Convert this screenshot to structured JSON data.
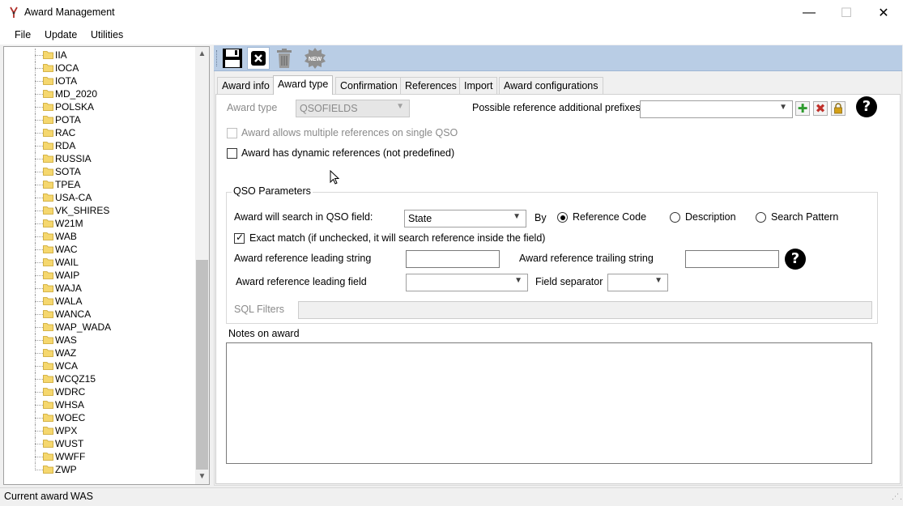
{
  "window": {
    "title": "Award Management",
    "minimize_glyph": "—",
    "maximize_glyph": "☐",
    "close_glyph": "✕"
  },
  "menu": {
    "items": [
      "File",
      "Update",
      "Utilities"
    ]
  },
  "tree": {
    "items": [
      "IIA",
      "IOCA",
      "IOTA",
      "MD_2020",
      "POLSKA",
      "POTA",
      "RAC",
      "RDA",
      "RUSSIA",
      "SOTA",
      "TPEA",
      "USA-CA",
      "VK_SHIRES",
      "W21M",
      "WAB",
      "WAC",
      "WAIL",
      "WAIP",
      "WAJA",
      "WALA",
      "WANCA",
      "WAP_WADA",
      "WAS",
      "WAZ",
      "WCA",
      "WCQZ15",
      "WDRC",
      "WHSA",
      "WOEC",
      "WPX",
      "WUST",
      "WWFF",
      "ZWP"
    ],
    "scroll_up_glyph": "▲",
    "scroll_down_glyph": "▼"
  },
  "toolbar": {
    "icons": [
      "save-icon",
      "close-icon",
      "delete-icon",
      "new-icon"
    ],
    "new_label": "NEW"
  },
  "tabs": [
    "Award info",
    "Award type",
    "Confirmation",
    "References",
    "Import",
    "Award configurations"
  ],
  "active_tab": "Award type",
  "award_type": {
    "label": "Award type",
    "value": "QSOFIELDS",
    "prefixes_label": "Possible reference additional prefixes",
    "prefixes_value": "",
    "multiple_refs_label": "Award allows multiple references on single QSO",
    "multiple_refs_checked": false,
    "dynamic_refs_label": "Award has dynamic references (not predefined)",
    "dynamic_refs_checked": false,
    "help_glyph": "?"
  },
  "qso_params": {
    "legend": "QSO Parameters",
    "search_field_label": "Award will search in QSO field:",
    "search_field_value": "State",
    "by_label": "By",
    "radio_options": [
      "Reference Code",
      "Description",
      "Search Pattern"
    ],
    "radio_selected": "Reference Code",
    "exact_match_label": "Exact match (if unchecked, it will search reference inside the field)",
    "exact_match_checked": true,
    "leading_string_label": "Award reference leading string",
    "leading_string_value": "",
    "trailing_string_label": "Award reference trailing string",
    "trailing_string_value": "",
    "leading_field_label": "Award reference leading field",
    "leading_field_value": "",
    "separator_label": "Field separator",
    "separator_value": "",
    "sql_filters_label": "SQL Filters",
    "sql_filters_value": ""
  },
  "notes": {
    "label": "Notes on award",
    "value": ""
  },
  "status": {
    "label": "Current award",
    "value": "WAS"
  },
  "colors": {
    "toolbar_bg": "#b9cde5",
    "folder": "#f5d76e",
    "add_green": "#2e9b2e",
    "remove_red": "#c0302a",
    "lock_gold": "#d4a017"
  }
}
